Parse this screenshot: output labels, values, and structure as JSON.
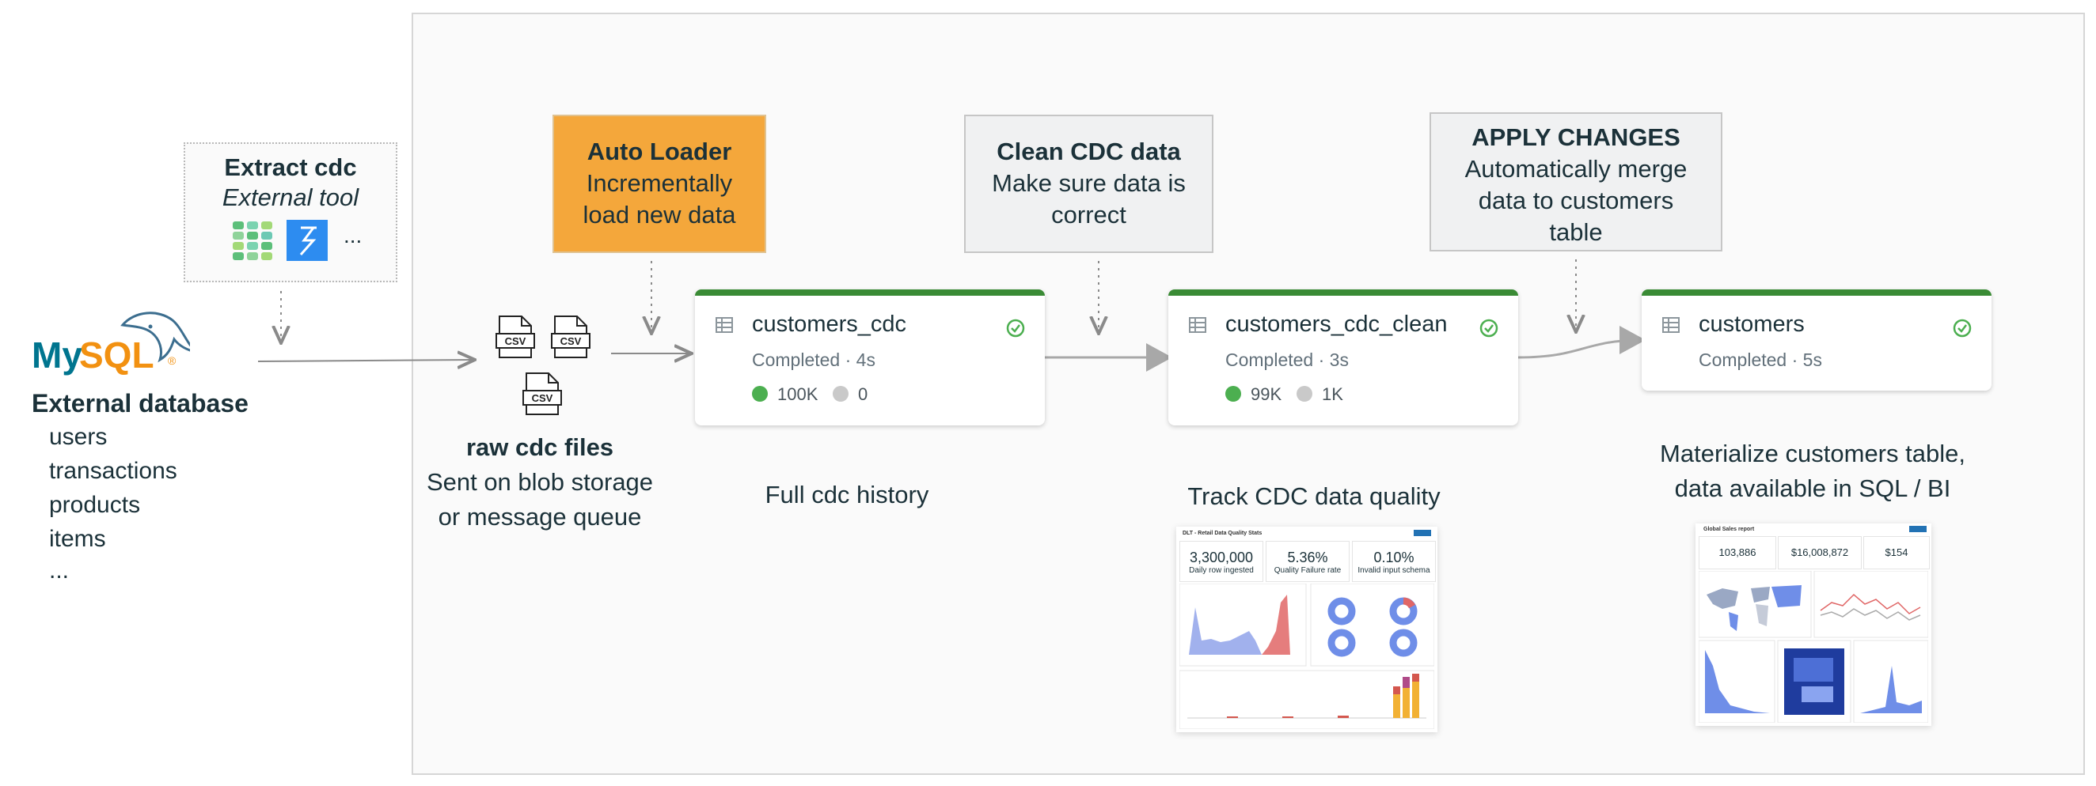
{
  "source": {
    "logo_text": "MySQL",
    "title": "External database",
    "tables": [
      "users",
      "transactions",
      "products",
      "items",
      "..."
    ]
  },
  "extract": {
    "title": "Extract cdc",
    "subtitle": "External tool",
    "more": "..."
  },
  "files": {
    "icon_label": "CSV",
    "title": "raw cdc files",
    "desc_line1": "Sent on blob storage",
    "desc_line2": "or message queue"
  },
  "steps": {
    "auto_loader": {
      "title": "Auto Loader",
      "line1": "Incrementally",
      "line2": "load new data",
      "color": "#f4a73b"
    },
    "clean": {
      "title": "Clean CDC data",
      "line1": "Make sure data is",
      "line2": "correct"
    },
    "apply": {
      "title": "APPLY CHANGES",
      "line1": "Automatically merge",
      "line2": "data to customers",
      "line3": "table"
    }
  },
  "tables": [
    {
      "name": "customers_cdc",
      "status": "Completed · 4s",
      "good": "100K",
      "bad": "0",
      "caption": "Full cdc history"
    },
    {
      "name": "customers_cdc_clean",
      "status": "Completed · 3s",
      "good": "99K",
      "bad": "1K",
      "caption": "Track CDC data quality"
    },
    {
      "name": "customers",
      "status": "Completed · 5s",
      "caption_line1": "Materialize customers table,",
      "caption_line2": "data available in SQL / BI"
    }
  ],
  "dq_dashboard": {
    "title": "DLT - Retail Data Quality Stats",
    "kpis": [
      {
        "value": "3,300,000",
        "label": "Daily row ingested"
      },
      {
        "value": "5.36%",
        "label": "Quality Failure rate"
      },
      {
        "value": "0.10%",
        "label": "Invalid input schema"
      }
    ]
  },
  "bi_dashboard": {
    "title": "Global Sales report",
    "kpis": [
      {
        "value": "103,886"
      },
      {
        "value": "$16,008,872"
      },
      {
        "value": "$154"
      }
    ]
  },
  "colors": {
    "card_accent": "#3a8b35",
    "good_dot": "#4caf50",
    "bad_dot": "#c9c9c9",
    "step_gray": "#f0f1f2"
  }
}
